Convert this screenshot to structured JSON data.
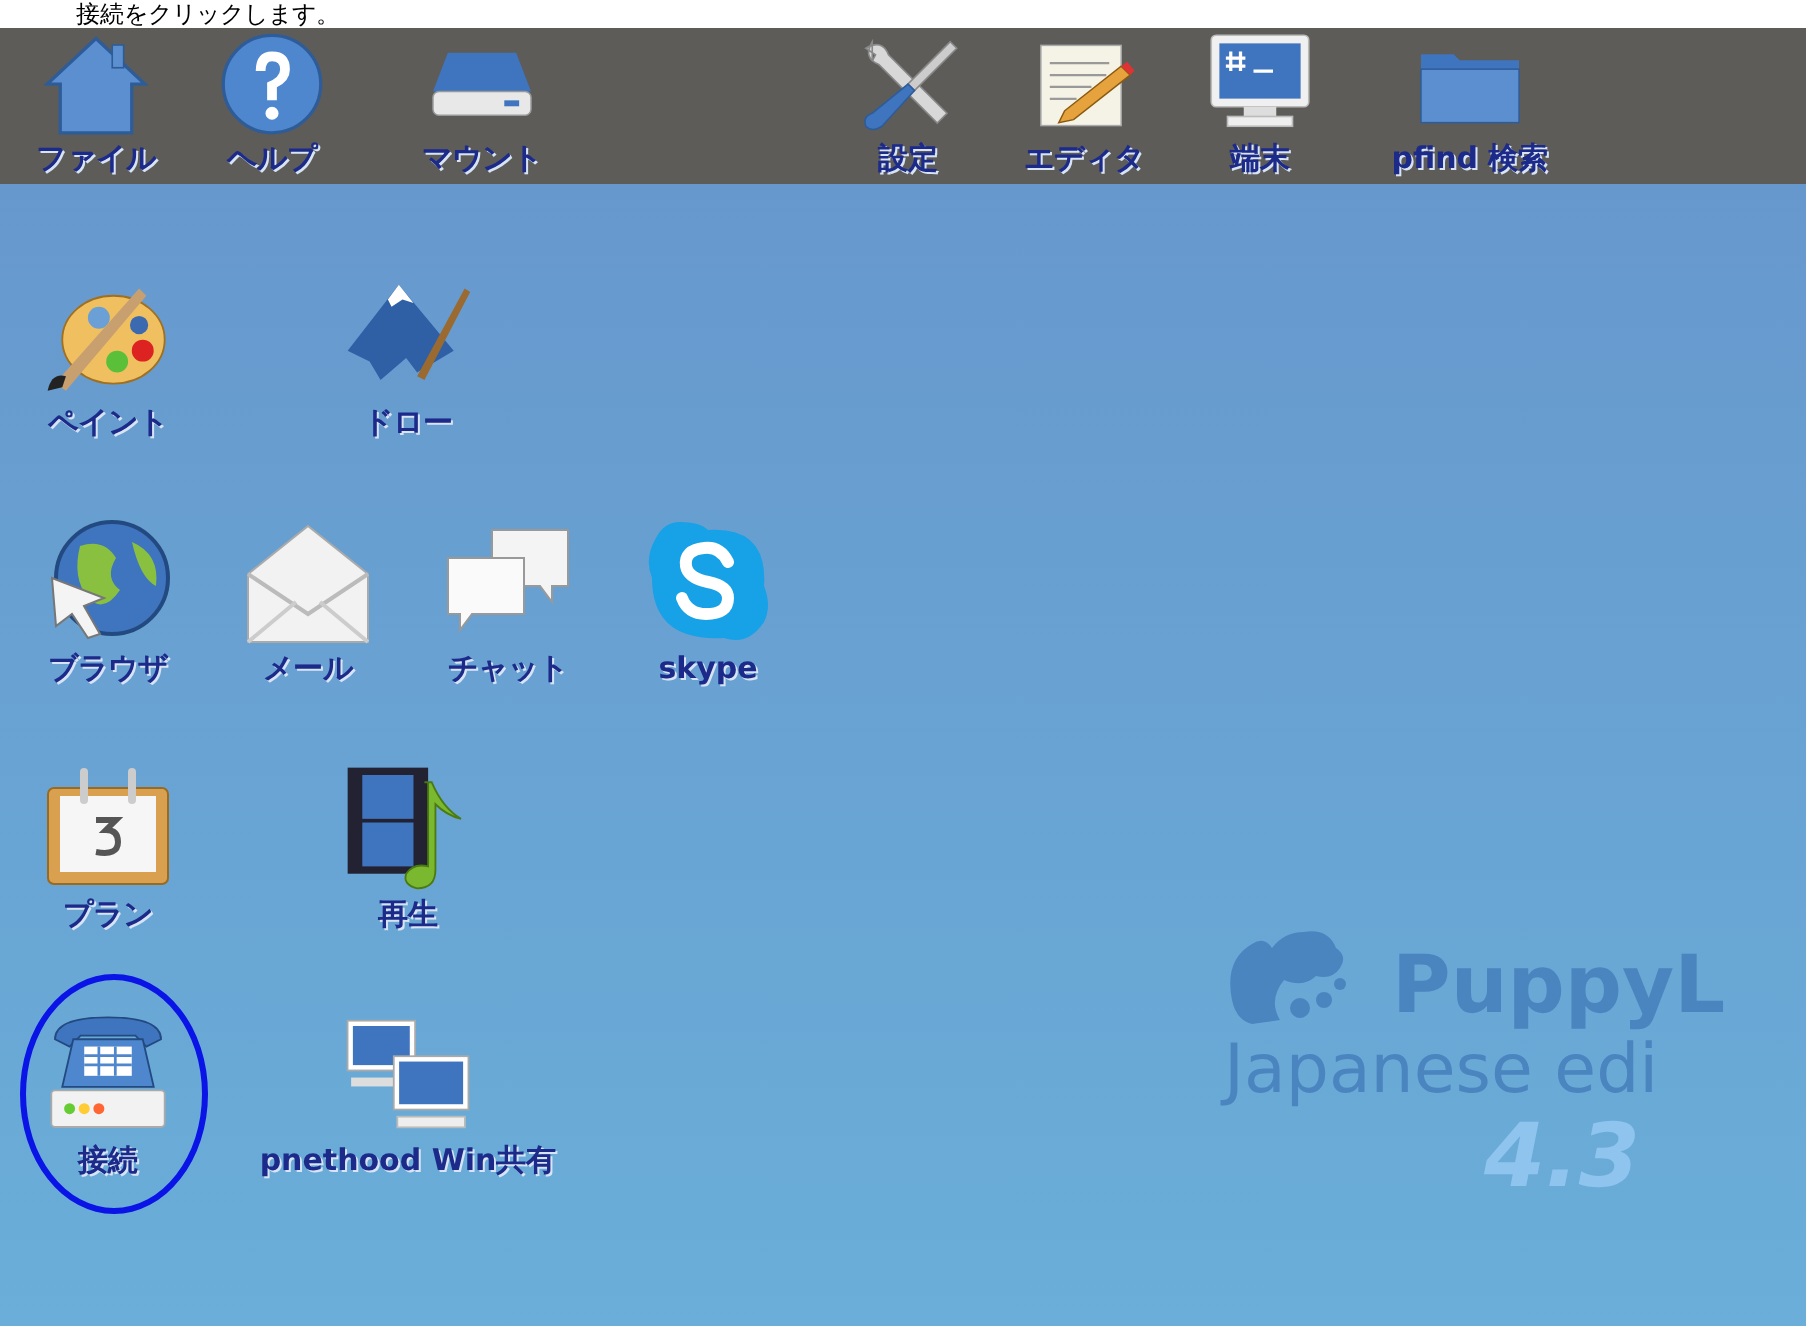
{
  "caption": "接続をクリックします。",
  "top_bar": {
    "left": [
      {
        "label": "ファイル",
        "kind": "house"
      },
      {
        "label": "ヘルプ",
        "kind": "help"
      },
      {
        "label": "マウント",
        "kind": "drive"
      }
    ],
    "right": [
      {
        "label": "設定",
        "kind": "tools"
      },
      {
        "label": "エディタ",
        "kind": "notepad"
      },
      {
        "label": "端末",
        "kind": "terminal"
      },
      {
        "label": "pfind 検索",
        "kind": "folder"
      }
    ]
  },
  "desktop": {
    "rows": [
      [
        {
          "label": "ペイント",
          "kind": "palette",
          "highlighted": false
        },
        {
          "label": "ドロー",
          "kind": "mountain",
          "highlighted": false
        }
      ],
      [
        {
          "label": "ブラウザ",
          "kind": "globe",
          "highlighted": false
        },
        {
          "label": "メール",
          "kind": "envelope",
          "highlighted": false
        },
        {
          "label": "チャット",
          "kind": "chat",
          "highlighted": false
        },
        {
          "label": "skype",
          "kind": "skype",
          "highlighted": false
        }
      ],
      [
        {
          "label": "プラン",
          "kind": "calendar",
          "highlighted": false
        },
        {
          "label": "再生",
          "kind": "media",
          "highlighted": false
        }
      ],
      [
        {
          "label": "接続",
          "kind": "phone",
          "highlighted": true
        },
        {
          "label": "pnethood Win共有",
          "kind": "computers",
          "highlighted": false
        }
      ]
    ]
  },
  "logo": {
    "line_1": "PuppyL",
    "line_2": "Japanese edi",
    "version": "4.3"
  }
}
